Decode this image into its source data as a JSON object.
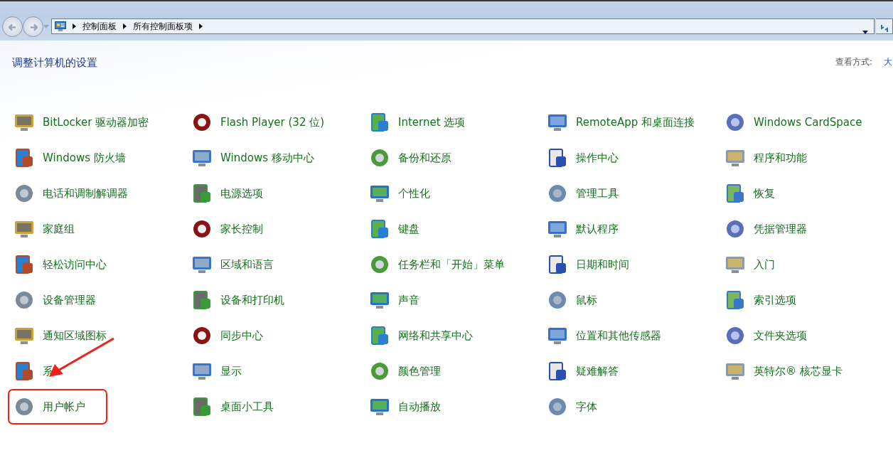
{
  "breadcrumb": [
    "控制面板",
    "所有控制面板项"
  ],
  "heading": "调整计算机的设置",
  "view_by": {
    "label": "查看方式:",
    "value": "大"
  },
  "items": [
    {
      "label": "BitLocker 驱动器加密",
      "marked": false
    },
    {
      "label": "Flash Player (32 位)",
      "marked": false
    },
    {
      "label": "Internet 选项",
      "marked": false
    },
    {
      "label": "RemoteApp 和桌面连接",
      "marked": false
    },
    {
      "label": "Windows CardSpace",
      "marked": false
    },
    {
      "label": "Windows 防火墙",
      "marked": false
    },
    {
      "label": "Windows 移动中心",
      "marked": false
    },
    {
      "label": "备份和还原",
      "marked": false
    },
    {
      "label": "操作中心",
      "marked": false
    },
    {
      "label": "程序和功能",
      "marked": false
    },
    {
      "label": "电话和调制解调器",
      "marked": false
    },
    {
      "label": "电源选项",
      "marked": false
    },
    {
      "label": "个性化",
      "marked": false
    },
    {
      "label": "管理工具",
      "marked": false
    },
    {
      "label": "恢复",
      "marked": false
    },
    {
      "label": "家庭组",
      "marked": false
    },
    {
      "label": "家长控制",
      "marked": false
    },
    {
      "label": "键盘",
      "marked": false
    },
    {
      "label": "默认程序",
      "marked": false
    },
    {
      "label": "凭据管理器",
      "marked": false
    },
    {
      "label": "轻松访问中心",
      "marked": false
    },
    {
      "label": "区域和语言",
      "marked": false
    },
    {
      "label": "任务栏和「开始」菜单",
      "marked": false
    },
    {
      "label": "日期和时间",
      "marked": false
    },
    {
      "label": "入门",
      "marked": false
    },
    {
      "label": "设备管理器",
      "marked": false
    },
    {
      "label": "设备和打印机",
      "marked": false
    },
    {
      "label": "声音",
      "marked": false
    },
    {
      "label": "鼠标",
      "marked": false
    },
    {
      "label": "索引选项",
      "marked": false
    },
    {
      "label": "通知区域图标",
      "marked": false
    },
    {
      "label": "同步中心",
      "marked": false
    },
    {
      "label": "网络和共享中心",
      "marked": false
    },
    {
      "label": "位置和其他传感器",
      "marked": false
    },
    {
      "label": "文件夹选项",
      "marked": false
    },
    {
      "label": "系",
      "marked": false
    },
    {
      "label": "显示",
      "marked": false
    },
    {
      "label": "颜色管理",
      "marked": false
    },
    {
      "label": "疑难解答",
      "marked": false
    },
    {
      "label": "英特尔® 核芯显卡",
      "marked": false
    },
    {
      "label": "用户帐户",
      "marked": true
    },
    {
      "label": "桌面小工具",
      "marked": false
    },
    {
      "label": "自动播放",
      "marked": false
    },
    {
      "label": "字体",
      "marked": false
    }
  ],
  "annotation_arrow": true
}
